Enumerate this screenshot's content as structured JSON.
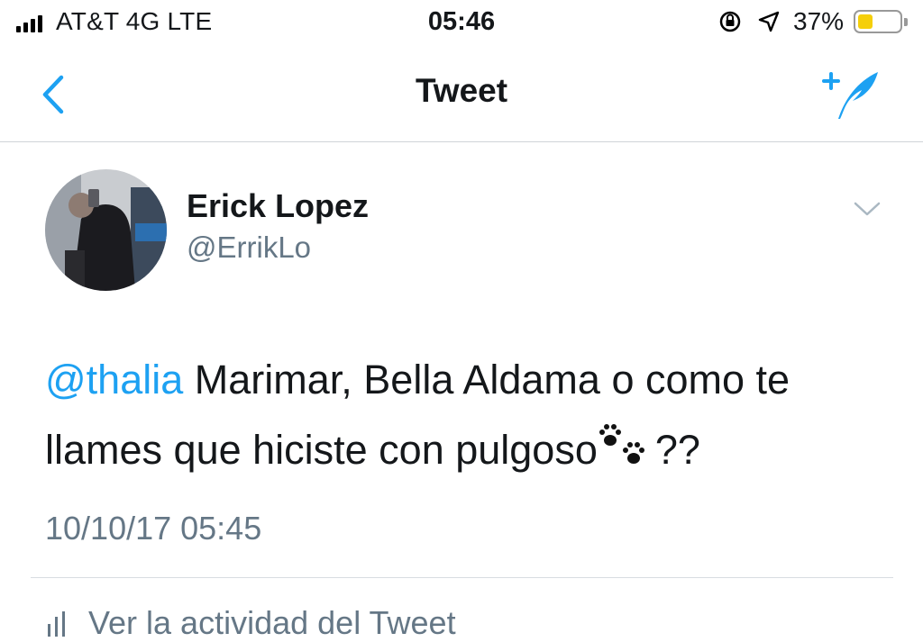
{
  "status_bar": {
    "carrier": "AT&T 4G  LTE",
    "time": "05:46",
    "battery_percent": "37%",
    "battery_level": 0.37,
    "icons": [
      "signal-bars-icon",
      "rotation-lock-icon",
      "location-arrow-icon",
      "battery-icon"
    ]
  },
  "nav": {
    "title": "Tweet",
    "back_icon": "chevron-left-icon",
    "compose_icon": "compose-tweet-icon"
  },
  "tweet": {
    "author_name": "Erick Lopez",
    "author_handle": "@ErrikLo",
    "mention": "@thalia",
    "text": " Marimar, Bella Aldama o como te llames que hiciste con pulgoso",
    "emoji": "🐾",
    "text_end": "??",
    "timestamp": "10/10/17 05:45",
    "menu_icon": "chevron-down-icon"
  },
  "actions": {
    "activity_label": "Ver la actividad del Tweet",
    "activity_icon": "analytics-bars-icon"
  },
  "colors": {
    "accent": "#1da1f2",
    "secondary_text": "#657786",
    "primary_text": "#14171a"
  }
}
